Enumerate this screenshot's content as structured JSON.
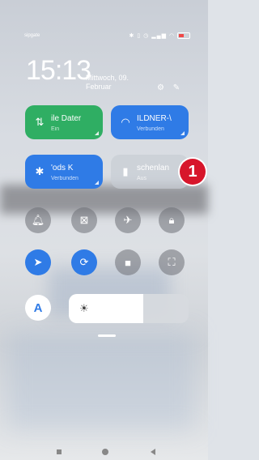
{
  "status_bar": {
    "carrier": "sipgate",
    "icons": [
      "bluetooth-icon",
      "vibrate-icon",
      "alarm-icon",
      "signal-icon",
      "wifi-icon",
      "battery-icon"
    ]
  },
  "clock": {
    "time": "15:13",
    "date": "Mittwoch, 09. Februar"
  },
  "header_icons": [
    "settings-icon",
    "edit-icon"
  ],
  "tiles": [
    {
      "name": "mobile-data",
      "title": "ile Dater",
      "subtitle": "Ein",
      "color": "#2fae63",
      "icon": "data-arrows-icon",
      "active": true
    },
    {
      "name": "wifi",
      "title": "ILDNER-\\",
      "subtitle": "Verbunden",
      "color": "#2f7be6",
      "icon": "wifi-icon",
      "active": true
    },
    {
      "name": "bluetooth",
      "title": "'ods     K",
      "subtitle": "Verbunden",
      "color": "#2f7be6",
      "icon": "bluetooth-icon",
      "active": true
    },
    {
      "name": "flashlight",
      "title": "schenlan",
      "subtitle": "Aus",
      "color": "#c8cdd4",
      "icon": "flashlight-icon",
      "active": false
    }
  ],
  "toggles_row1": [
    {
      "name": "bell",
      "icon": "bell-icon",
      "active": false
    },
    {
      "name": "screenshot",
      "icon": "screenshot-icon",
      "active": false
    },
    {
      "name": "airplane",
      "icon": "airplane-icon",
      "active": false
    },
    {
      "name": "lock",
      "icon": "lock-icon",
      "active": false
    }
  ],
  "toggles_row2": [
    {
      "name": "location",
      "icon": "location-arrow-icon",
      "active": true
    },
    {
      "name": "rotation-lock",
      "icon": "rotation-lock-icon",
      "active": true
    },
    {
      "name": "screen-record",
      "icon": "video-camera-icon",
      "active": false
    },
    {
      "name": "scanner",
      "icon": "scan-frame-icon",
      "active": false
    }
  ],
  "auto_brightness": {
    "label": "A"
  },
  "brightness": {
    "level_percent": 62
  },
  "annotation": {
    "label": "1",
    "color": "#d7162b"
  }
}
